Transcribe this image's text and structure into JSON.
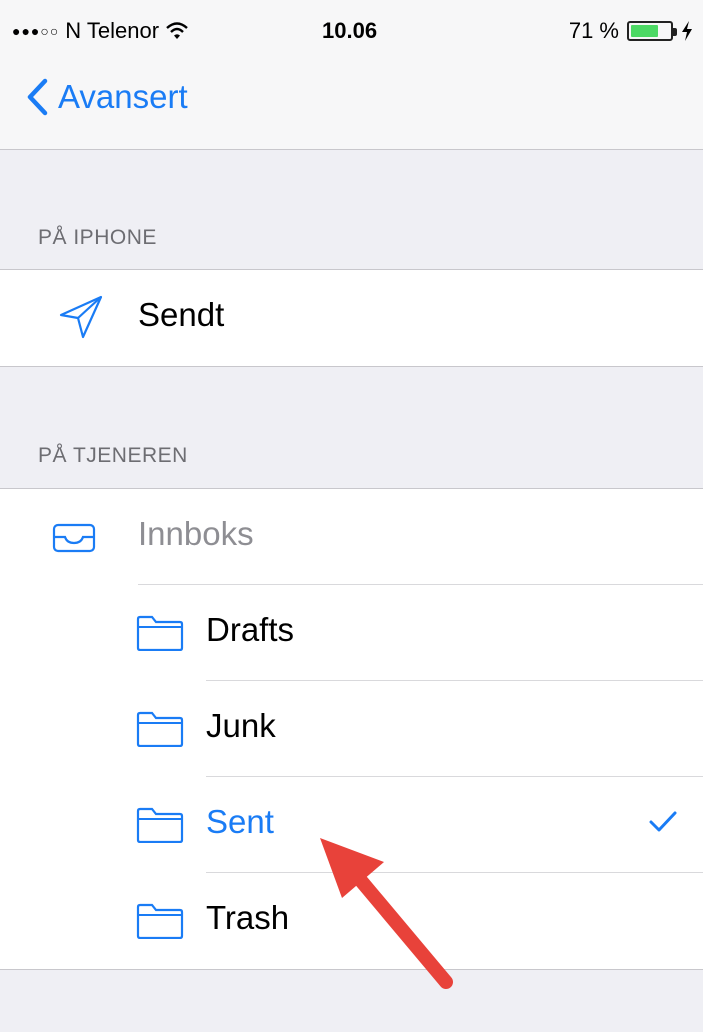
{
  "status_bar": {
    "carrier": "N Telenor",
    "time": "10.06",
    "battery": "71 %",
    "battery_level": 0.71,
    "signal_icon": "signal-dots",
    "wifi_icon": "wifi-icon",
    "charging_icon": "bolt-icon"
  },
  "nav": {
    "back_label": "Avansert",
    "back_icon": "chevron-left-icon"
  },
  "sections": {
    "on_iphone": "PÅ IPHONE",
    "on_server": "PÅ TJENEREN"
  },
  "iphone_mailbox": {
    "label": "Sendt",
    "icon": "paper-plane-icon"
  },
  "server_mailboxes": {
    "inbox": "Innboks",
    "drafts": "Drafts",
    "junk": "Junk",
    "sent": "Sent",
    "trash": "Trash"
  },
  "selected": "Sent",
  "colors": {
    "accent": "#1a7cf5",
    "background": "#efeff4",
    "disabled_text": "#8e8e93",
    "battery_green": "#4cd964",
    "annotation_arrow": "#e8423a"
  }
}
